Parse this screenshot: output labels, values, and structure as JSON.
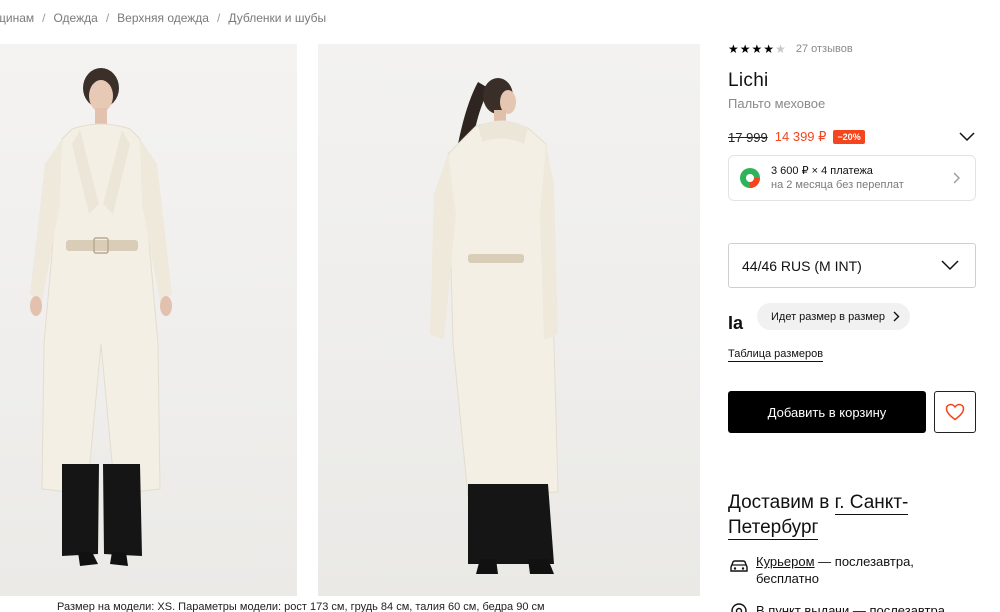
{
  "breadcrumb": [
    "щинам",
    "Одежда",
    "Верхняя одежда",
    "Дубленки и шубы"
  ],
  "gallery": {
    "model_params": "Размер на модели: XS. Параметры модели: рост 173 см, грудь 84 см, талия 60 см, бедра 90 см"
  },
  "product": {
    "rating": 4,
    "rating_max": 5,
    "reviews": "27 отзывов",
    "brand": "Lichi",
    "type": "Пальто меховое",
    "old_price": "17 999",
    "new_price": "14 399 ₽",
    "discount": "−20%"
  },
  "installment": {
    "title": "3 600 ₽ × 4 платежа",
    "subtitle": "на 2 месяца без переплат"
  },
  "size": {
    "selected": "44/46 RUS (M INT)",
    "fit_logo": "Ia",
    "fit_prompt": "Идет размер в размер",
    "table_link": "Таблица размеров"
  },
  "actions": {
    "add_to_cart": "Добавить в корзину"
  },
  "delivery": {
    "title": "Доставим в",
    "city": "г. Санкт-Петербург",
    "courier_link": "Курьером",
    "courier_text": " — послезавтра, бесплатно",
    "pickup_link": "В пункт выдачи",
    "pickup_text": " — послезавтра"
  },
  "colors": {
    "accent": "#f5451e",
    "button": "#000000",
    "coat": "#f3efe4"
  }
}
